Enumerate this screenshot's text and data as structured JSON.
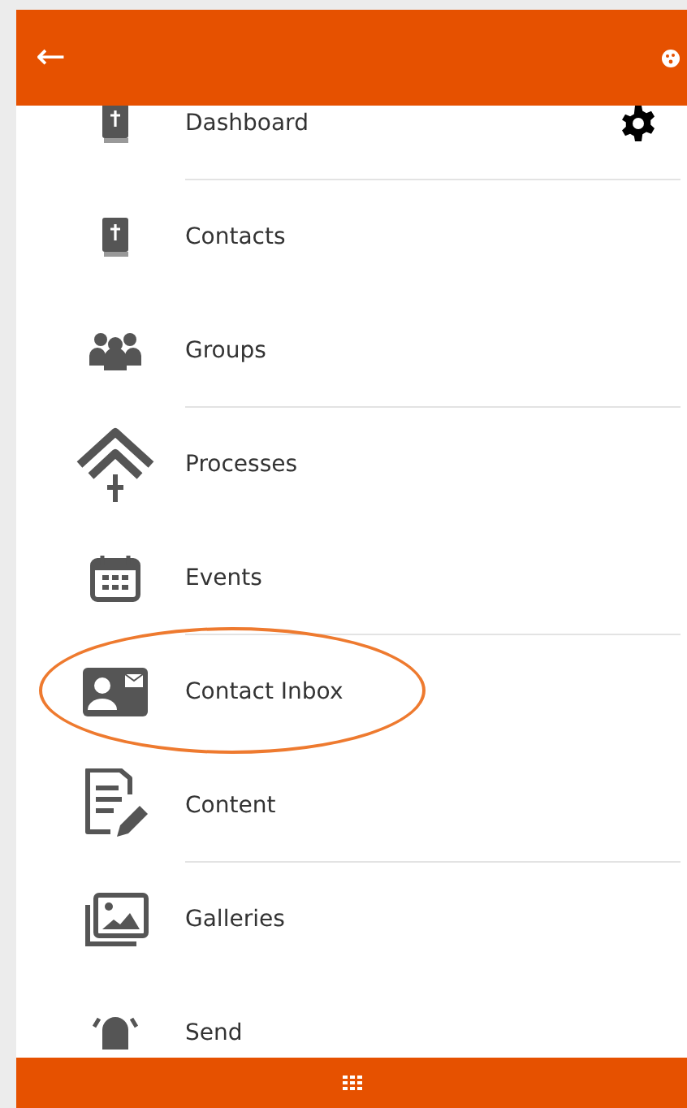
{
  "header": {
    "back_icon": "←"
  },
  "menu_items": [
    {
      "label": "Dashboard",
      "divider": true,
      "circled": false,
      "settings": true
    },
    {
      "label": "Contacts",
      "divider": false,
      "circled": false,
      "settings": false
    },
    {
      "label": "Groups",
      "divider": true,
      "circled": false,
      "settings": false
    },
    {
      "label": "Processes",
      "divider": false,
      "circled": false,
      "settings": false
    },
    {
      "label": "Events",
      "divider": true,
      "circled": false,
      "settings": false
    },
    {
      "label": "Contact Inbox",
      "divider": false,
      "circled": true,
      "settings": false
    },
    {
      "label": "Content",
      "divider": true,
      "circled": false,
      "settings": false
    },
    {
      "label": "Galleries",
      "divider": false,
      "circled": false,
      "settings": false
    },
    {
      "label": "Send",
      "circled": false,
      "settings": false
    }
  ]
}
